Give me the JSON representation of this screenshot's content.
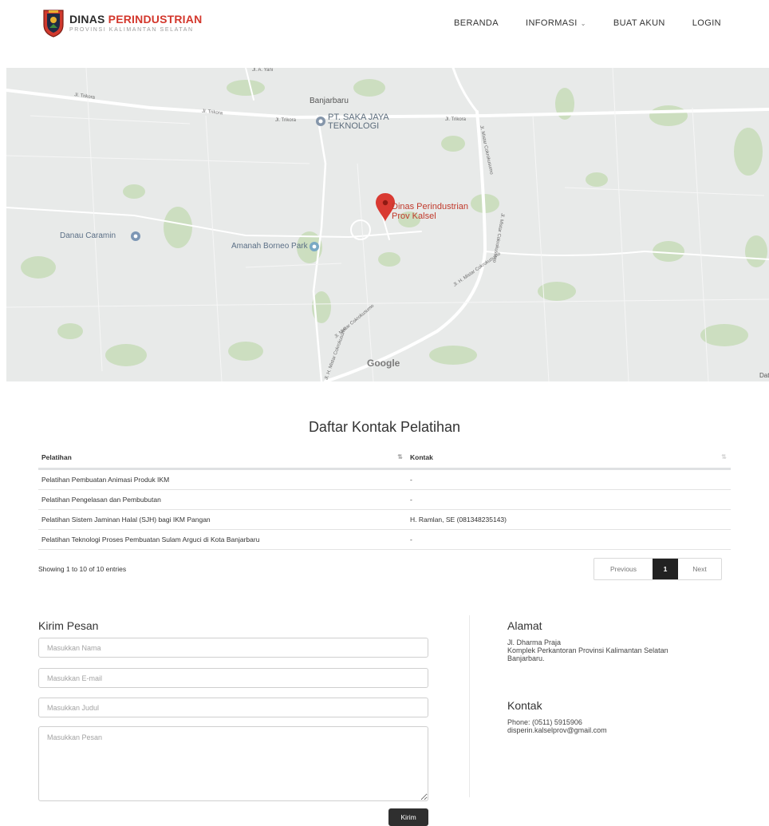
{
  "header": {
    "logo_title_part1": "DINAS",
    "logo_title_part2": "PERINDUSTRIAN",
    "logo_subtitle": "PROVINSI KALIMANTAN SELATAN",
    "nav": [
      {
        "label": "BERANDA"
      },
      {
        "label": "INFORMASI"
      },
      {
        "label": "BUAT AKUN"
      },
      {
        "label": "LOGIN"
      }
    ]
  },
  "map": {
    "roads": [
      "Jl. Trikora",
      "Jl. Trikora",
      "Jl. Trikora",
      "Jl. Trikora",
      "Jl. Mistar Cokrokusumo",
      "Jl. Mistar Cokrokusumo",
      "Jl. H. Mistar Cokrokusumo",
      "Jl. Mistar Cokrokusumo",
      "Jl. H. Mistar Cokrokusumo",
      "Jl. A. Yani"
    ],
    "city": "Banjarbaru",
    "poi_business_line1": "PT. SAKA JAYA",
    "poi_business_line2": "TEKNOLOGI",
    "marker_line1": "Dinas Perindustrian",
    "marker_line2": "Prov Kalsel",
    "poi_lake": "Danau Caramin",
    "poi_park": "Amanah Borneo Park",
    "attribution": "Google",
    "data_label": "Dat",
    "colors": {
      "marker": "#d93a32",
      "park": "#c7dcb8",
      "road": "#ffffff"
    }
  },
  "table_section": {
    "title": "Daftar Kontak Pelatihan",
    "columns": [
      "Pelatihan",
      "Kontak"
    ],
    "sort_icon": "⇅",
    "rows": [
      [
        "Pelatihan Pembuatan Animasi Produk IKM",
        "-"
      ],
      [
        "Pelatihan Pengelasan dan Pembubutan",
        "-"
      ],
      [
        "Pelatihan Sistem Jaminan Halal (SJH) bagi IKM Pangan",
        "H. Ramlan, SE (081348235143)"
      ],
      [
        "Pelatihan Teknologi Proses Pembuatan Sulam Arguci di Kota Banjarbaru",
        "-"
      ]
    ],
    "info": "Showing 1 to 10 of 10 entries",
    "pagination": {
      "previous": "Previous",
      "current": "1",
      "next": "Next"
    }
  },
  "contact_form": {
    "title": "Kirim Pesan",
    "name_placeholder": "Masukkan Nama",
    "email_placeholder": "Masukkan E-mail",
    "subject_placeholder": "Masukkan Judul",
    "message_placeholder": "Masukkan Pesan",
    "submit_label": "Kirim"
  },
  "address": {
    "title": "Alamat",
    "line1": "Jl. Dharma Praja",
    "line2": "Komplek Perkantoran Provinsi Kalimantan Selatan",
    "line3": "Banjarbaru."
  },
  "contact": {
    "title": "Kontak",
    "phone": "Phone: (0511) 5915906",
    "email": "disperin.kalselprov@gmail.com"
  }
}
